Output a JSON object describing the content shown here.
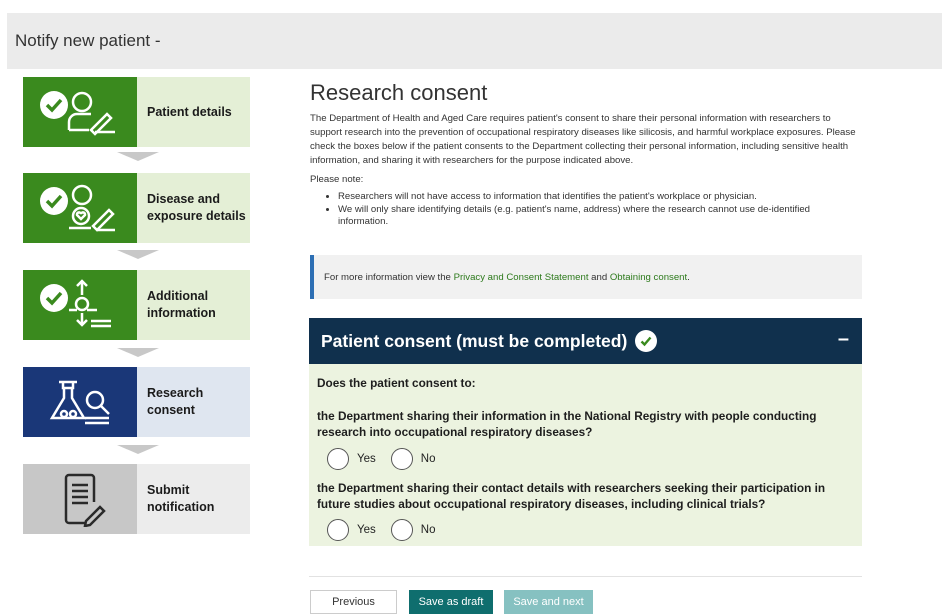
{
  "header": {
    "title": "Notify new patient -"
  },
  "steps": [
    {
      "label": "Patient details",
      "icon": "person-icon",
      "status": "done"
    },
    {
      "label": "Disease and exposure details",
      "icon": "person-heart-icon",
      "status": "done"
    },
    {
      "label": "Additional information",
      "icon": "upload-download-icon",
      "status": "done"
    },
    {
      "label": "Research consent",
      "icon": "flask-search-icon",
      "status": "current"
    },
    {
      "label": "Submit notification",
      "icon": "document-pen-icon",
      "status": "pending"
    }
  ],
  "main": {
    "heading": "Research consent",
    "intro": "The Department of Health and Aged Care requires patient's consent to share their personal information with researchers to support research into the prevention of occupational respiratory diseases like silicosis, and harmful workplace exposures. Please check the boxes below if the patient consents to the Department collecting their personal information, including sensitive health information, and sharing it with researchers for the purpose indicated above.",
    "note_heading": "Please note:",
    "notes": [
      "Researchers will not have access to information that identifies the patient's workplace or physician.",
      "We will only share identifying details (e.g. patient's name, address) where the research cannot use de-identified information."
    ]
  },
  "info": {
    "prefix": "For more information view the ",
    "link1": "Privacy and Consent Statement",
    "middle": " and ",
    "link2": "Obtaining consent",
    "suffix": "."
  },
  "panel": {
    "title": "Patient consent (must be completed)",
    "collapse": "–",
    "prompt": "Does the patient consent to:",
    "q1": "the Department sharing their information in the National Registry with people conducting research into occupational respiratory diseases?",
    "q2": "the Department sharing their contact details with researchers seeking their participation in future studies about occupational respiratory diseases, including clinical trials?",
    "yes": "Yes",
    "no": "No"
  },
  "buttons": {
    "previous": "Previous",
    "draft": "Save as draft",
    "next": "Save and next"
  },
  "colors": {
    "done": "#3a8a1e",
    "current": "#1a3778",
    "panel_header": "#10304d",
    "panel_body": "#ecf3e0",
    "draft_button": "#0f6e6e"
  }
}
